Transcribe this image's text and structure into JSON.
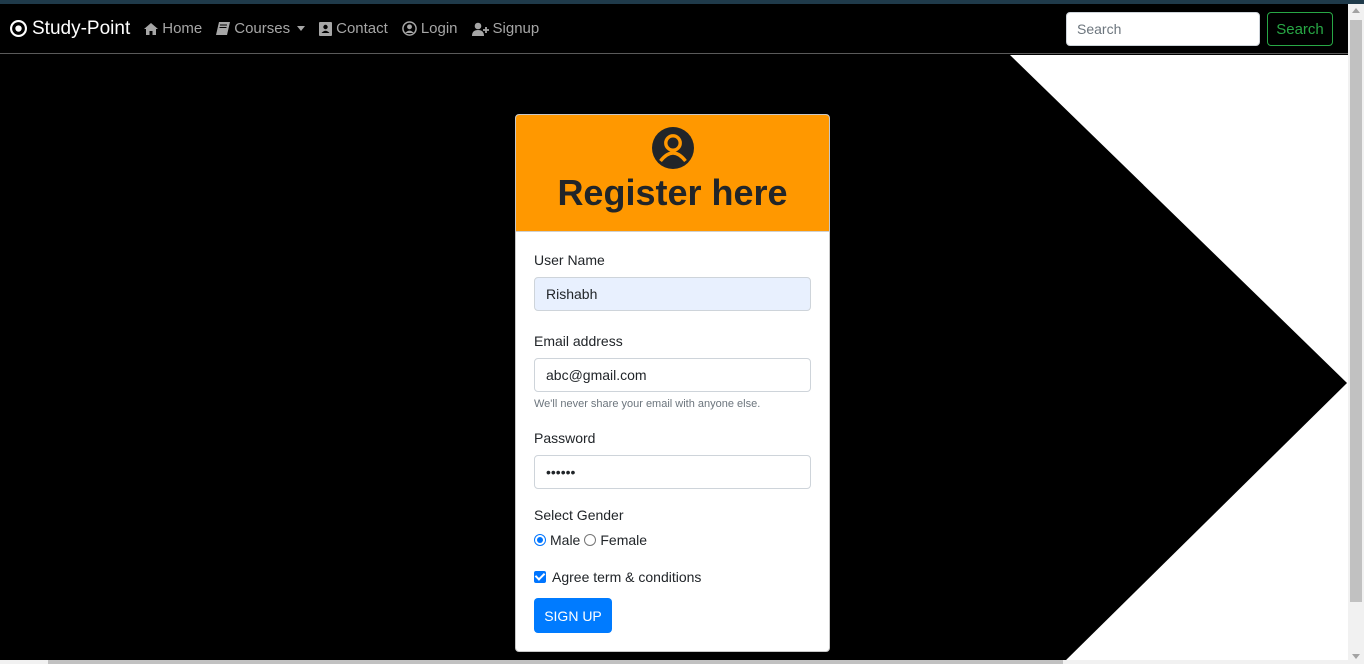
{
  "navbar": {
    "brand": "Study-Point",
    "items": [
      {
        "label": "Home",
        "icon": "home-icon"
      },
      {
        "label": "Courses",
        "icon": "book-icon"
      },
      {
        "label": "Contact",
        "icon": "contact-book-icon"
      },
      {
        "label": "Login",
        "icon": "user-circle-icon"
      },
      {
        "label": "Signup",
        "icon": "user-plus-icon"
      }
    ],
    "search_placeholder": "Search",
    "search_button": "Search"
  },
  "form": {
    "title": "Register here",
    "username_label": "User Name",
    "username_value": "Rishabh",
    "email_label": "Email address",
    "email_value": "abc@gmail.com",
    "email_help": "We'll never share your email with anyone else.",
    "password_label": "Password",
    "password_value": "••••••",
    "gender_label": "Select Gender",
    "gender_options": [
      "Male",
      "Female"
    ],
    "gender_selected": "Male",
    "agree_label": "Agree term & conditions",
    "agree_checked": true,
    "submit_label": "SIGN UP"
  },
  "colors": {
    "header_accent": "#ff9800",
    "primary": "#007bff",
    "success": "#28a745"
  }
}
